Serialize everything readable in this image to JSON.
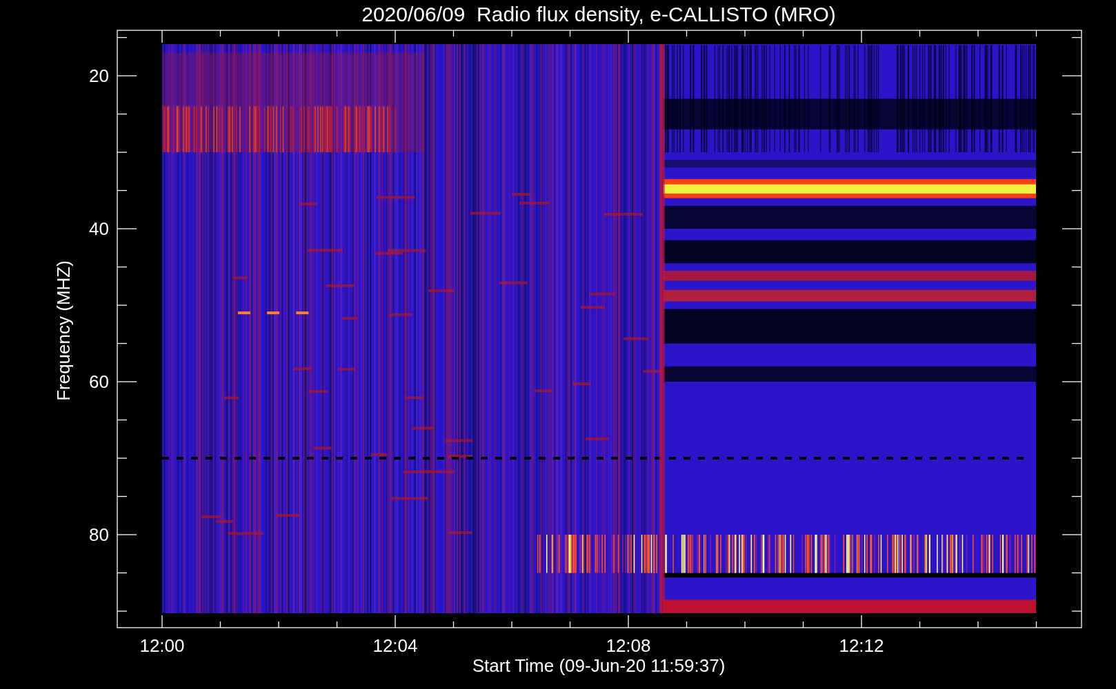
{
  "title": "2020/06/09  Radio flux density, e-CALLISTO (MRO)",
  "xlabel": "Start Time (09-Jun-20 11:59:37)",
  "ylabel": "Frequency (MHZ)",
  "xticks": [
    "12:00",
    "12:04",
    "12:08",
    "12:12"
  ],
  "yticks": [
    "20",
    "40",
    "60",
    "80"
  ]
}
